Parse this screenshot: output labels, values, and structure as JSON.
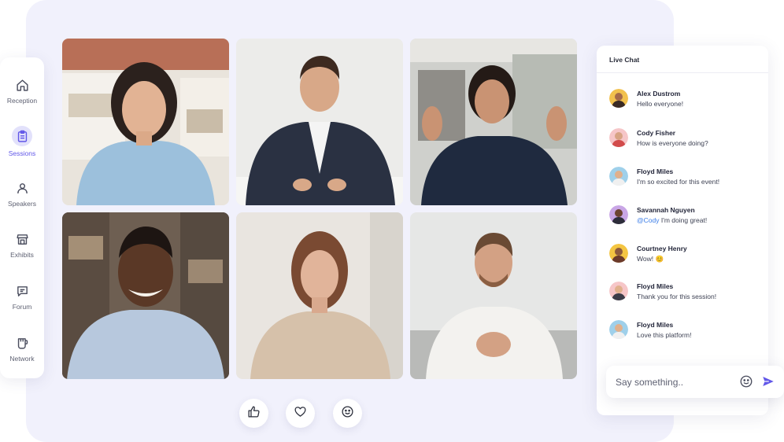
{
  "sidebar": {
    "items": [
      {
        "label": "Reception",
        "icon": "home-icon",
        "active": false
      },
      {
        "label": "Sessions",
        "icon": "clipboard-icon",
        "active": true
      },
      {
        "label": "Speakers",
        "icon": "user-icon",
        "active": false
      },
      {
        "label": "Exhibits",
        "icon": "store-icon",
        "active": false
      },
      {
        "label": "Forum",
        "icon": "chat-bubble-icon",
        "active": false
      },
      {
        "label": "Network",
        "icon": "cup-icon",
        "active": false
      }
    ]
  },
  "reactions": [
    {
      "name": "thumbs-up-icon"
    },
    {
      "name": "heart-icon"
    },
    {
      "name": "smiley-icon"
    }
  ],
  "chat": {
    "title": "Live Chat",
    "messages": [
      {
        "name": "Alex Dustrom",
        "text": "Hello everyone!"
      },
      {
        "name": "Cody Fisher",
        "text": "How is everyone doing?"
      },
      {
        "name": "Floyd Miles",
        "text": "I'm so excited for this event!"
      },
      {
        "name": "Savannah Nguyen",
        "mention": "@Cody",
        "text": "I'm doing great!"
      },
      {
        "name": "Courtney Henry",
        "text": "Wow! 😊"
      },
      {
        "name": "Floyd Miles",
        "text": "Thank you for this session!"
      },
      {
        "name": "Floyd Miles",
        "text": "Love this platform!"
      }
    ],
    "input_placeholder": "Say something.."
  },
  "colors": {
    "accent": "#6157e8",
    "panel_background": "#f1f1fc",
    "mention": "#3b7de8"
  }
}
